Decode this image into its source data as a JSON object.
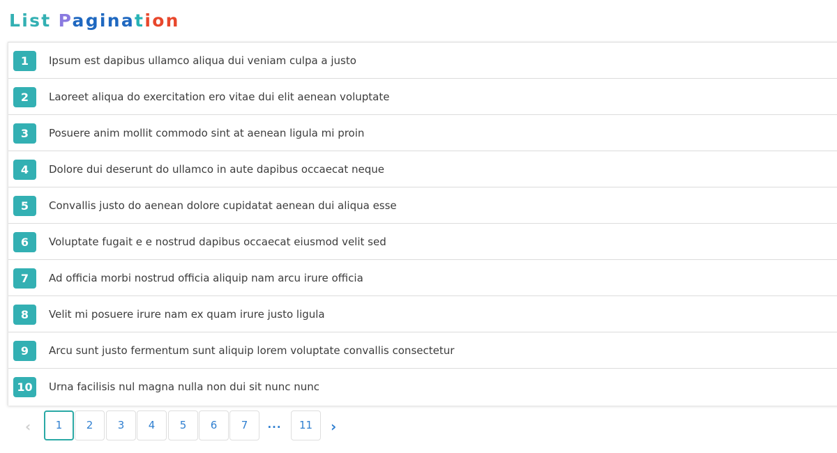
{
  "title": {
    "words": [
      {
        "letters": [
          {
            "char": "L",
            "color": "#33b0b3"
          },
          {
            "char": "i",
            "color": "#33b0b3"
          },
          {
            "char": "s",
            "color": "#33b0b3"
          },
          {
            "char": "t",
            "color": "#33b0b3"
          }
        ]
      },
      {
        "letters": [
          {
            "char": "P",
            "color": "#8a7ae0"
          },
          {
            "char": "a",
            "color": "#1f68c0"
          },
          {
            "char": "g",
            "color": "#1f68c0"
          },
          {
            "char": "i",
            "color": "#1f68c0"
          },
          {
            "char": "n",
            "color": "#1f68c0"
          },
          {
            "char": "a",
            "color": "#1f68c0"
          },
          {
            "char": "t",
            "color": "#27b3b5"
          },
          {
            "char": "i",
            "color": "#e8472c"
          },
          {
            "char": "o",
            "color": "#e8472c"
          },
          {
            "char": "n",
            "color": "#e8472c"
          }
        ]
      }
    ]
  },
  "list": {
    "items": [
      {
        "number": "1",
        "text": "Ipsum est dapibus ullamco aliqua dui veniam culpa a justo"
      },
      {
        "number": "2",
        "text": "Laoreet aliqua do exercitation ero vitae dui elit aenean voluptate"
      },
      {
        "number": "3",
        "text": "Posuere anim mollit commodo sint at aenean ligula mi proin"
      },
      {
        "number": "4",
        "text": "Dolore dui deserunt do ullamco in aute dapibus occaecat neque"
      },
      {
        "number": "5",
        "text": "Convallis justo do aenean dolore cupidatat aenean dui aliqua esse"
      },
      {
        "number": "6",
        "text": "Voluptate fugait e e nostrud dapibus occaecat eiusmod velit sed"
      },
      {
        "number": "7",
        "text": "Ad officia morbi nostrud officia aliquip nam arcu irure officia"
      },
      {
        "number": "8",
        "text": "Velit mi posuere irure nam ex quam irure justo ligula"
      },
      {
        "number": "9",
        "text": "Arcu sunt justo fermentum sunt aliquip lorem voluptate convallis consectetur"
      },
      {
        "number": "10",
        "text": "Urna facilisis nul magna nulla non dui sit nunc nunc"
      }
    ]
  },
  "pagination": {
    "prev_icon": "chevron-left-icon",
    "prev_glyph": "‹",
    "next_icon": "chevron-right-icon",
    "next_glyph": "›",
    "pages": [
      {
        "label": "1",
        "active": true
      },
      {
        "label": "2",
        "active": false
      },
      {
        "label": "3",
        "active": false
      },
      {
        "label": "4",
        "active": false
      },
      {
        "label": "5",
        "active": false
      },
      {
        "label": "6",
        "active": false
      },
      {
        "label": "7",
        "active": false
      },
      {
        "label": "...",
        "active": false,
        "ellipsis": true
      },
      {
        "label": "11",
        "active": false
      }
    ]
  },
  "colors": {
    "accent": "#33b0b3",
    "link": "#2f7fd0",
    "active_border": "#2aa9a5",
    "disabled": "#cfcfcf"
  }
}
